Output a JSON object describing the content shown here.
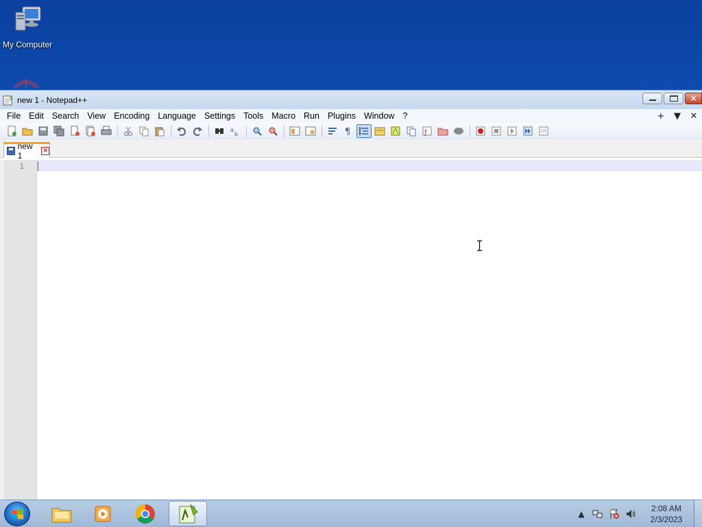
{
  "desktop": {
    "icons": [
      {
        "label": "My Computer",
        "icon": "computer-icon"
      }
    ]
  },
  "window": {
    "title": "new 1 - Notepad++",
    "controls": {
      "minimize": "minimize",
      "maximize": "maximize",
      "close": "×"
    }
  },
  "menubar": {
    "items": [
      "File",
      "Edit",
      "Search",
      "View",
      "Encoding",
      "Language",
      "Settings",
      "Tools",
      "Macro",
      "Run",
      "Plugins",
      "Window",
      "?"
    ],
    "right": [
      "+",
      "▼",
      "✕"
    ]
  },
  "toolbar": {
    "groups": [
      [
        "new-file-icon",
        "open-file-icon",
        "save-icon",
        "save-all-icon",
        "close-icon",
        "close-all-icon",
        "print-icon"
      ],
      [
        "cut-icon",
        "copy-icon",
        "paste-icon"
      ],
      [
        "undo-icon",
        "redo-icon"
      ],
      [
        "find-icon",
        "replace-icon"
      ],
      [
        "zoom-in-icon",
        "zoom-out-icon"
      ],
      [
        "sync-vertical-icon",
        "sync-horizontal-icon"
      ],
      [
        "word-wrap-icon",
        "show-all-chars-icon",
        "indent-guide-icon",
        "udl-icon",
        "doc-map-icon",
        "doc-list-icon",
        "function-list-icon",
        "folder-workspace-icon",
        "monitor-icon"
      ],
      [
        "record-macro-icon",
        "stop-macro-icon",
        "play-macro-icon",
        "run-macro-multiple-icon",
        "save-macro-icon"
      ]
    ],
    "active_icon": "indent-guide-icon"
  },
  "tabs": [
    {
      "label": "new 1",
      "close": "×"
    }
  ],
  "editor": {
    "line_numbers": [
      "1"
    ],
    "content": ""
  },
  "taskbar": {
    "apps": [
      "explorer-icon",
      "media-player-icon",
      "chrome-icon",
      "notepadpp-icon"
    ],
    "active_app": "notepadpp-icon",
    "tray": {
      "show_hidden": "▲",
      "time": "2:08 AM",
      "date": "2/3/2023"
    }
  },
  "colors": {
    "tab_accent": "#f7a21a",
    "current_line": "#e8e8ff",
    "caret": "#4444ff"
  }
}
